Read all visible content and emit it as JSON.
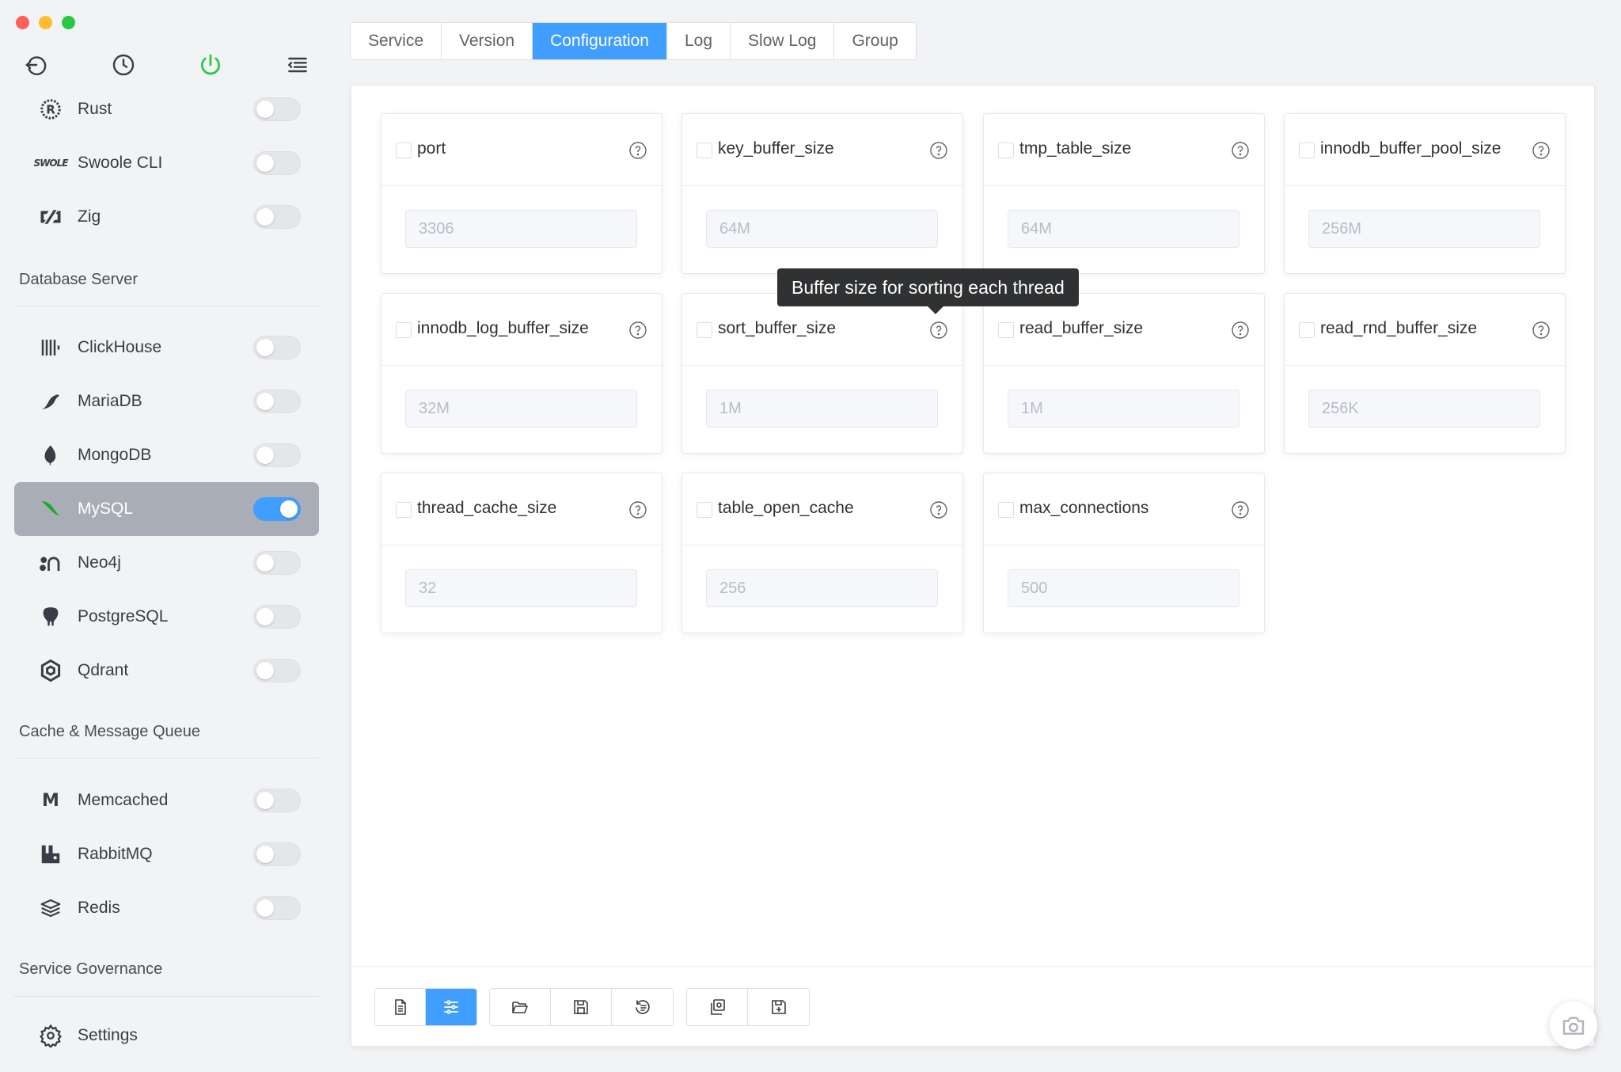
{
  "tabs": [
    "Service",
    "Version",
    "Configuration",
    "Log",
    "Slow Log",
    "Group"
  ],
  "active_tab": "Configuration",
  "sidebar": {
    "top_items": [
      {
        "label": "Rust",
        "icon": "rust-icon",
        "enabled": false
      },
      {
        "label": "Swoole CLI",
        "icon": "swoole-icon",
        "icon_text": "SWOLE",
        "enabled": false
      },
      {
        "label": "Zig",
        "icon": "zig-icon",
        "enabled": false
      }
    ],
    "sections": {
      "database": {
        "title": "Database Server",
        "items": [
          {
            "label": "ClickHouse",
            "icon": "clickhouse-icon",
            "enabled": false
          },
          {
            "label": "MariaDB",
            "icon": "mariadb-icon",
            "enabled": false
          },
          {
            "label": "MongoDB",
            "icon": "mongodb-icon",
            "enabled": false
          },
          {
            "label": "MySQL",
            "icon": "mysql-icon",
            "enabled": true
          },
          {
            "label": "Neo4j",
            "icon": "neo4j-icon",
            "enabled": false
          },
          {
            "label": "PostgreSQL",
            "icon": "postgresql-icon",
            "enabled": false
          },
          {
            "label": "Qdrant",
            "icon": "qdrant-icon",
            "enabled": false
          }
        ]
      },
      "cache": {
        "title": "Cache & Message Queue",
        "items": [
          {
            "label": "Memcached",
            "icon": "memcached-icon",
            "icon_text": "M",
            "enabled": false
          },
          {
            "label": "RabbitMQ",
            "icon": "rabbitmq-icon",
            "enabled": false
          },
          {
            "label": "Redis",
            "icon": "redis-icon",
            "enabled": false
          }
        ]
      },
      "governance": {
        "title": "Service Governance",
        "items": [
          {
            "label": "Settings",
            "icon": "gear-icon"
          }
        ]
      }
    }
  },
  "config_cards": [
    {
      "name": "port",
      "value": "3306"
    },
    {
      "name": "key_buffer_size",
      "value": "64M"
    },
    {
      "name": "tmp_table_size",
      "value": "64M"
    },
    {
      "name": "innodb_buffer_pool_size",
      "value": "256M"
    },
    {
      "name": "innodb_log_buffer_size",
      "value": "32M"
    },
    {
      "name": "sort_buffer_size",
      "value": "1M"
    },
    {
      "name": "read_buffer_size",
      "value": "1M"
    },
    {
      "name": "read_rnd_buffer_size",
      "value": "256K"
    },
    {
      "name": "thread_cache_size",
      "value": "32"
    },
    {
      "name": "table_open_cache",
      "value": "256"
    },
    {
      "name": "max_connections",
      "value": "500"
    }
  ],
  "tooltip": {
    "text": "Buffer size for sorting each thread"
  },
  "colors": {
    "accent": "#409eff",
    "active_nav_bg": "#a9aeb6",
    "tooltip_bg": "#303133",
    "power_icon": "#28c840"
  }
}
